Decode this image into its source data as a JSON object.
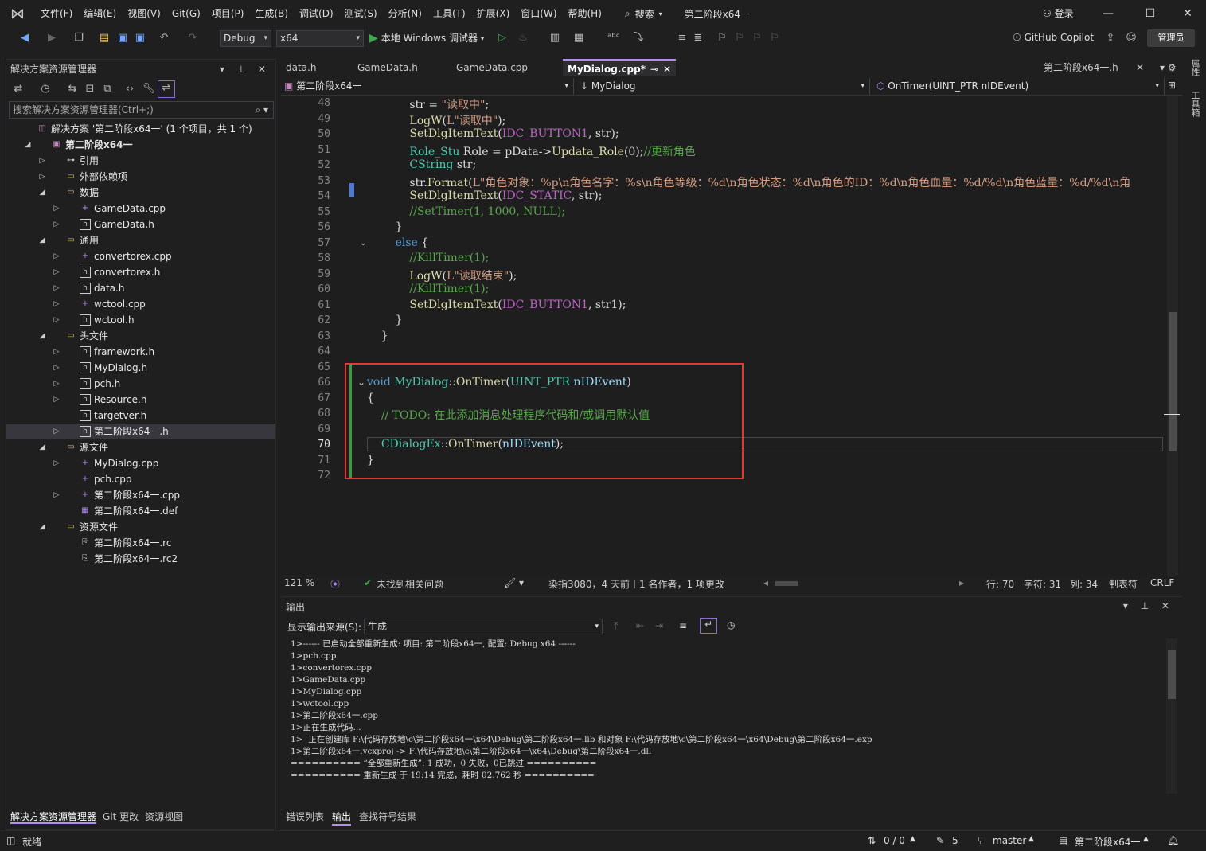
{
  "menu": {
    "items": [
      "文件(F)",
      "编辑(E)",
      "视图(V)",
      "Git(G)",
      "项目(P)",
      "生成(B)",
      "调试(D)",
      "测试(S)",
      "分析(N)",
      "工具(T)",
      "扩展(X)",
      "窗口(W)",
      "帮助(H)"
    ],
    "search_label": "搜索",
    "solution_name": "第二阶段x64一",
    "login": "登录"
  },
  "toolbar": {
    "config": "Debug",
    "platform": "x64",
    "run_label": "本地 Windows 调试器",
    "copilot": "GitHub Copilot",
    "admin": "管理员"
  },
  "solution_explorer": {
    "title": "解决方案资源管理器",
    "search_placeholder": "搜索解决方案资源管理器(Ctrl+;)",
    "tree": [
      {
        "label": "解决方案 '第二阶段x64一' (1 个项目，共 1 个)",
        "depth": 0,
        "arrow": "",
        "icon": "solution-icon"
      },
      {
        "label": "第二阶段x64一",
        "depth": 1,
        "arrow": "open",
        "icon": "project-icon",
        "bold": true
      },
      {
        "label": "引用",
        "depth": 2,
        "arrow": "closed",
        "icon": "references-icon"
      },
      {
        "label": "外部依赖项",
        "depth": 2,
        "arrow": "closed",
        "icon": "folder-icon"
      },
      {
        "label": "数据",
        "depth": 2,
        "arrow": "open",
        "icon": "folder-icon"
      },
      {
        "label": "GameData.cpp",
        "depth": 3,
        "arrow": "closed",
        "icon": "cpp-file-icon"
      },
      {
        "label": "GameData.h",
        "depth": 3,
        "arrow": "closed",
        "icon": "header-file-icon"
      },
      {
        "label": "通用",
        "depth": 2,
        "arrow": "open",
        "icon": "folder-icon"
      },
      {
        "label": "convertorex.cpp",
        "depth": 3,
        "arrow": "closed",
        "icon": "cpp-file-icon"
      },
      {
        "label": "convertorex.h",
        "depth": 3,
        "arrow": "closed",
        "icon": "header-file-icon"
      },
      {
        "label": "data.h",
        "depth": 3,
        "arrow": "closed",
        "icon": "header-file-icon"
      },
      {
        "label": "wctool.cpp",
        "depth": 3,
        "arrow": "closed",
        "icon": "cpp-file-icon"
      },
      {
        "label": "wctool.h",
        "depth": 3,
        "arrow": "closed",
        "icon": "header-file-icon"
      },
      {
        "label": "头文件",
        "depth": 2,
        "arrow": "open",
        "icon": "folder-icon"
      },
      {
        "label": "framework.h",
        "depth": 3,
        "arrow": "closed",
        "icon": "header-file-icon"
      },
      {
        "label": "MyDialog.h",
        "depth": 3,
        "arrow": "closed",
        "icon": "header-file-icon"
      },
      {
        "label": "pch.h",
        "depth": 3,
        "arrow": "closed",
        "icon": "header-file-icon"
      },
      {
        "label": "Resource.h",
        "depth": 3,
        "arrow": "closed",
        "icon": "header-file-icon"
      },
      {
        "label": "targetver.h",
        "depth": 3,
        "arrow": "",
        "icon": "header-file-icon"
      },
      {
        "label": "第二阶段x64一.h",
        "depth": 3,
        "arrow": "closed",
        "icon": "header-file-icon",
        "selected": true
      },
      {
        "label": "源文件",
        "depth": 2,
        "arrow": "open",
        "icon": "folder-icon"
      },
      {
        "label": "MyDialog.cpp",
        "depth": 3,
        "arrow": "closed",
        "icon": "cpp-file-icon"
      },
      {
        "label": "pch.cpp",
        "depth": 3,
        "arrow": "",
        "icon": "cpp-file-icon"
      },
      {
        "label": "第二阶段x64一.cpp",
        "depth": 3,
        "arrow": "closed",
        "icon": "cpp-file-icon"
      },
      {
        "label": "第二阶段x64一.def",
        "depth": 3,
        "arrow": "",
        "icon": "def-file-icon"
      },
      {
        "label": "资源文件",
        "depth": 2,
        "arrow": "open",
        "icon": "folder-icon"
      },
      {
        "label": "第二阶段x64一.rc",
        "depth": 3,
        "arrow": "",
        "icon": "rc-file-icon"
      },
      {
        "label": "第二阶段x64一.rc2",
        "depth": 3,
        "arrow": "",
        "icon": "rc-file-icon"
      }
    ],
    "bottom_tabs": [
      "解决方案资源管理器",
      "Git 更改",
      "资源视图"
    ]
  },
  "editor": {
    "tabs": [
      "data.h",
      "GameData.h",
      "GameData.cpp",
      "MyDialog.cpp*"
    ],
    "right_tab": "第二阶段x64一.h",
    "nav": {
      "project": "第二阶段x64一",
      "scope": "MyDialog",
      "member": "OnTimer(UINT_PTR nIDEvent)"
    },
    "current_line": "70",
    "lines": [
      {
        "n": "48",
        "html": "            str = <span class='str'>\"读取中\"</span>;"
      },
      {
        "n": "49",
        "html": "            <span class='fn'>LogW</span>(<span class='str'>L\"读取中\"</span>);"
      },
      {
        "n": "50",
        "html": "            <span class='fn'>SetDlgItemText</span>(<span class='mac'>IDC_BUTTON1</span>, str);"
      },
      {
        "n": "51",
        "html": "            <span class='ty'>Role_Stu</span> Role = pData-><span class='fn'>Updata_Role</span>(0);<span class='cm'>//更新角色</span>"
      },
      {
        "n": "52",
        "html": "            <span class='ty'>CString</span> str;"
      },
      {
        "n": "53",
        "html": "            str.<span class='fn'>Format</span>(<span class='str'>L\"角色对象：%p\\n角色名字：%s\\n角色等级：%d\\n角色状态：%d\\n角色的ID：%d\\n角色血量：%d/%d\\n角色蓝量：%d/%d\\n角</span>"
      },
      {
        "n": "54",
        "html": "            <span class='fn'>SetDlgItemText</span>(<span class='mac'>IDC_STATIC</span>, str);"
      },
      {
        "n": "55",
        "html": "            <span class='cm'>//SetTimer(1, 1000, NULL);</span>"
      },
      {
        "n": "56",
        "html": "        }"
      },
      {
        "n": "57",
        "html": "        <span class='kw'>else</span> {"
      },
      {
        "n": "58",
        "html": "            <span class='cm'>//KillTimer(1);</span>"
      },
      {
        "n": "59",
        "html": "            <span class='fn'>LogW</span>(<span class='str'>L\"读取结束\"</span>);"
      },
      {
        "n": "60",
        "html": "            <span class='cm'>//KillTimer(1);</span>"
      },
      {
        "n": "61",
        "html": "            <span class='fn'>SetDlgItemText</span>(<span class='mac'>IDC_BUTTON1</span>, str1);"
      },
      {
        "n": "62",
        "html": "        }"
      },
      {
        "n": "63",
        "html": "    }"
      },
      {
        "n": "64",
        "html": ""
      },
      {
        "n": "65",
        "html": ""
      },
      {
        "n": "66",
        "html": "<span class='kw'>void</span> <span class='ty'>MyDialog</span>::<span class='fn'>OnTimer</span>(<span class='ty'>UINT_PTR</span> <span class='var'>nIDEvent</span>)"
      },
      {
        "n": "67",
        "html": "{"
      },
      {
        "n": "68",
        "html": "    <span class='cm'>// TODO: 在此添加消息处理程序代码和/或调用默认值</span>"
      },
      {
        "n": "69",
        "html": ""
      },
      {
        "n": "70",
        "html": "    <span class='ty'>CDialogEx</span>::<span class='fn'>OnTimer</span>(<span class='var'>nIDEvent</span>);"
      },
      {
        "n": "71",
        "html": "}"
      },
      {
        "n": "72",
        "html": ""
      }
    ]
  },
  "editor_status": {
    "zoom": "121 %",
    "issues": "未找到相关问题",
    "git_blame": "染指3080，4 天前丨1 名作者，1 项更改",
    "row": "行: 70",
    "char": "字符: 31",
    "col": "列: 34",
    "tabs": "制表符",
    "eol": "CRLF"
  },
  "output": {
    "title": "输出",
    "source_label": "显示输出来源(S):",
    "source_value": "生成",
    "lines": [
      "1>------ 已启动全部重新生成: 项目: 第二阶段x64一, 配置: Debug x64 ------",
      "1>pch.cpp",
      "1>convertorex.cpp",
      "1>GameData.cpp",
      "1>MyDialog.cpp",
      "1>wctool.cpp",
      "1>第二阶段x64一.cpp",
      "1>正在生成代码...",
      "1>  正在创建库 F:\\代码存放地\\c\\第二阶段x64一\\x64\\Debug\\第二阶段x64一.lib 和对象 F:\\代码存放地\\c\\第二阶段x64一\\x64\\Debug\\第二阶段x64一.exp",
      "1>第二阶段x64一.vcxproj -> F:\\代码存放地\\c\\第二阶段x64一\\x64\\Debug\\第二阶段x64一.dll",
      "========== “全部重新生成”: 1 成功，0 失败，0已跳过 ==========",
      "========== 重新生成 于 19:14 完成，耗时 02.762 秒 =========="
    ],
    "tabs": [
      "错误列表",
      "输出",
      "查找符号结果"
    ]
  },
  "right_strip": {
    "properties": "属性",
    "toolbox": "工具箱"
  },
  "statusbar": {
    "ready": "就绪",
    "changes": "0 / 0",
    "edits": "5",
    "branch": "master",
    "repo": "第二阶段x64一"
  }
}
